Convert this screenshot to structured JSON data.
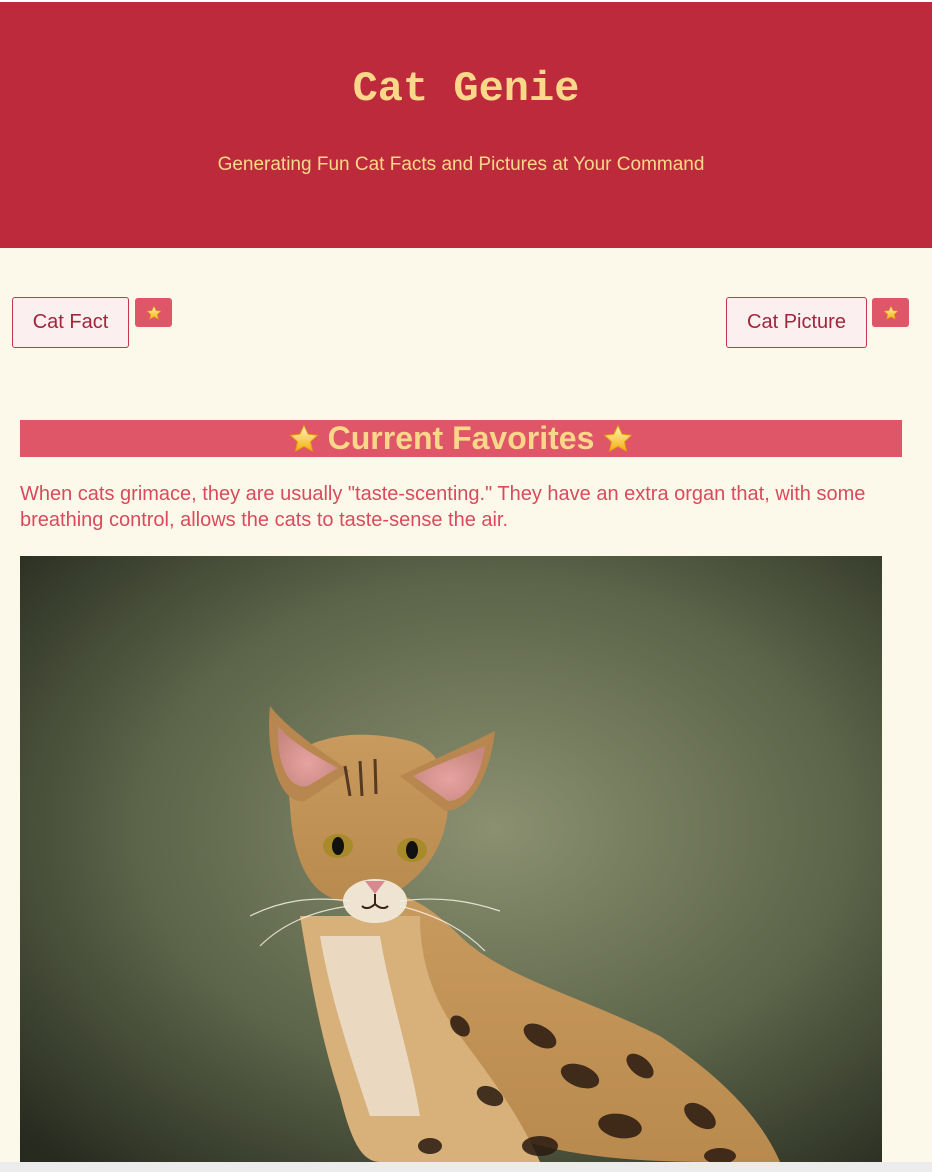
{
  "header": {
    "title": "Cat Genie",
    "tagline": "Generating Fun Cat Facts and Pictures at Your Command"
  },
  "actions": {
    "cat_fact_label": "Cat Fact",
    "cat_picture_label": "Cat Picture",
    "favorite_icon": "star-icon"
  },
  "favorites": {
    "heading": "Current Favorites",
    "heading_icon": "star-icon",
    "fact": "When cats grimace, they are usually \"taste-scenting.\" They have an extra organ that, with some breathing control, allows the cats to taste-sense the air.",
    "picture_subject": "savannah-cat-photo"
  },
  "colors": {
    "header_bg": "#bd2a3c",
    "accent_yellow": "#fbd889",
    "favorites_bar": "#df5668",
    "page_bg": "#fdf9ea",
    "fact_text": "#d94a5c"
  }
}
